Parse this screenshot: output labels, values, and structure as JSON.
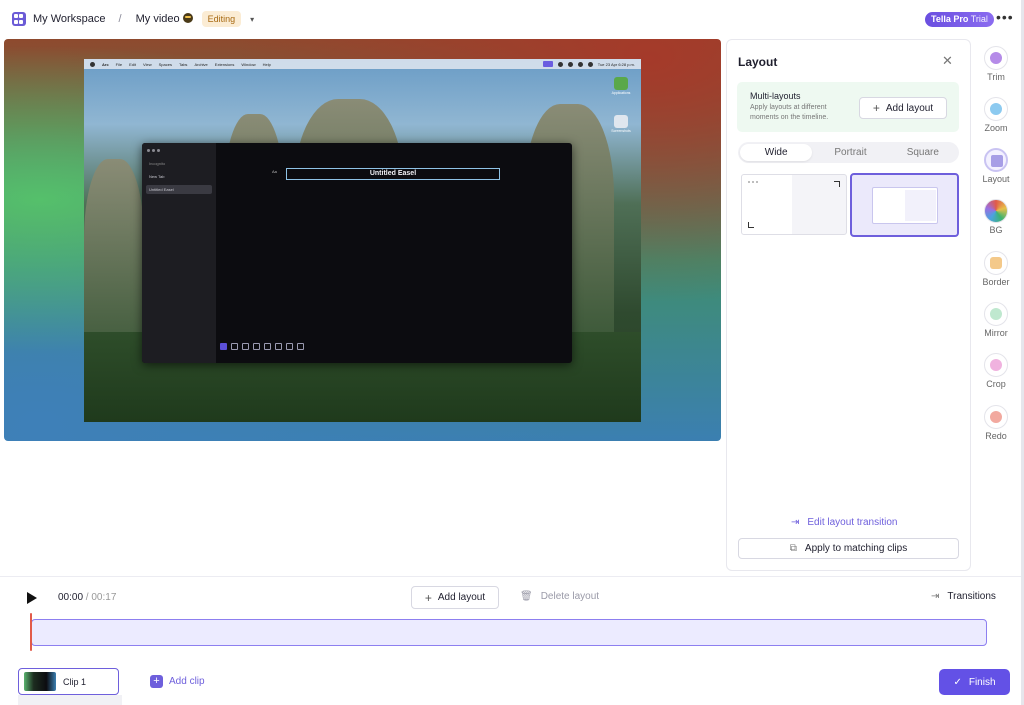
{
  "header": {
    "workspace": "My Workspace",
    "separator": "/",
    "video_title": "My video",
    "status": "Editing",
    "pro_badge": "Tella Pro",
    "pro_badge_suffix": " Trial",
    "more_icon": "more-horizontal-icon"
  },
  "preview": {
    "menubar": {
      "items": [
        "Arc",
        "File",
        "Edit",
        "View",
        "Spaces",
        "Tabs",
        "Archive",
        "Extensions",
        "Window",
        "Help"
      ],
      "clock": "Tue 23 Apr 6:28 p.m."
    },
    "desktop_icons": [
      "Applications",
      "Screenshots"
    ],
    "sidebar": {
      "items": [
        "Incognito",
        "New Tab",
        "Untitled Easel"
      ]
    },
    "canvas_title": "Untitled Easel",
    "text_tool_label": "Aa"
  },
  "layout_panel": {
    "title": "Layout",
    "multi_title": "Multi-layouts",
    "multi_desc": "Apply layouts at different moments on the timeline.",
    "add_layout": "Add layout",
    "tabs": [
      {
        "label": "Wide",
        "active": true
      },
      {
        "label": "Portrait",
        "active": false
      },
      {
        "label": "Square",
        "active": false
      }
    ],
    "edit_transition": "Edit layout transition",
    "apply_matching": "Apply to matching clips"
  },
  "tools": [
    {
      "label": "Trim",
      "icon": "scissors-icon",
      "color": "#9b6fe0"
    },
    {
      "label": "Zoom",
      "icon": "zoom-icon",
      "color": "#4aa3e0"
    },
    {
      "label": "Layout",
      "icon": "layout-icon",
      "color": "#7c70d8"
    },
    {
      "label": "BG",
      "icon": "background-icon",
      "color": "#3cb371"
    },
    {
      "label": "Border",
      "icon": "border-icon",
      "color": "#e8a44a"
    },
    {
      "label": "Mirror",
      "icon": "mirror-icon",
      "color": "#5cc08a"
    },
    {
      "label": "Crop",
      "icon": "crop-icon",
      "color": "#d85fb8"
    },
    {
      "label": "Redo",
      "icon": "redo-icon",
      "color": "#e05a4a"
    }
  ],
  "timeline": {
    "current": "00:00",
    "total": " / 00:17",
    "add_layout": "Add layout",
    "delete_layout": "Delete layout",
    "transitions": "Transitions",
    "clip_label": "Clip 1",
    "add_clip": "Add clip",
    "finish": "Finish"
  }
}
